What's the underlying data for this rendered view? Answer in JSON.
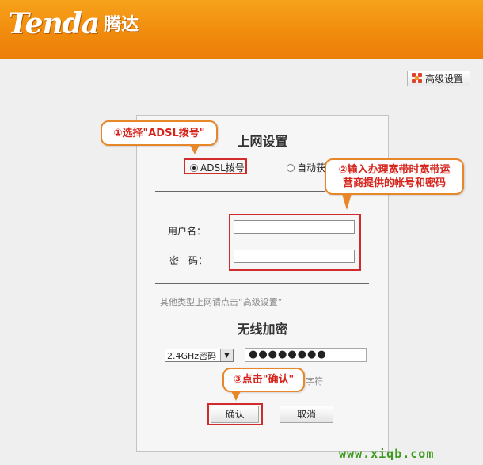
{
  "header": {
    "brand_logo": "Tenda",
    "brand_cn": "腾达",
    "colors": {
      "header_gradient_top": "#f7a21b",
      "header_gradient_bottom": "#ec7e08",
      "brand_text": "#ffffff"
    }
  },
  "toolbar": {
    "advanced_settings_label": "高级设置",
    "advanced_settings_icon": "settings-grid-icon"
  },
  "internet_section": {
    "title": "上网设置",
    "options": [
      {
        "label": "ADSL拨号",
        "selected": true
      },
      {
        "label": "自动获",
        "selected": false
      }
    ],
    "username_label": "用户名：",
    "username_value": "",
    "password_label": "密　码：",
    "password_value": "",
    "other_types_note": "其他类型上网请点击“高级设置”"
  },
  "wireless_section": {
    "title": "无线加密",
    "password_type_selected": "2.4GHz密码",
    "wifi_password_masked": "●●●●●●●●",
    "hint_partial": "字符"
  },
  "buttons": {
    "confirm_label": "确认",
    "cancel_label": "取消"
  },
  "annotations": {
    "callout_1": "①选择\"ADSL拨号\"",
    "callout_2_line1": "②输入办理宽带时宽带运",
    "callout_2_line2": "营商提供的帐号和密码",
    "callout_3": "③点击\"确认\"",
    "colors": {
      "callout_border": "#e8872a",
      "callout_text": "#d6251c",
      "highlight_box": "#d12b2b"
    }
  },
  "watermark": "www.xiqb.com"
}
